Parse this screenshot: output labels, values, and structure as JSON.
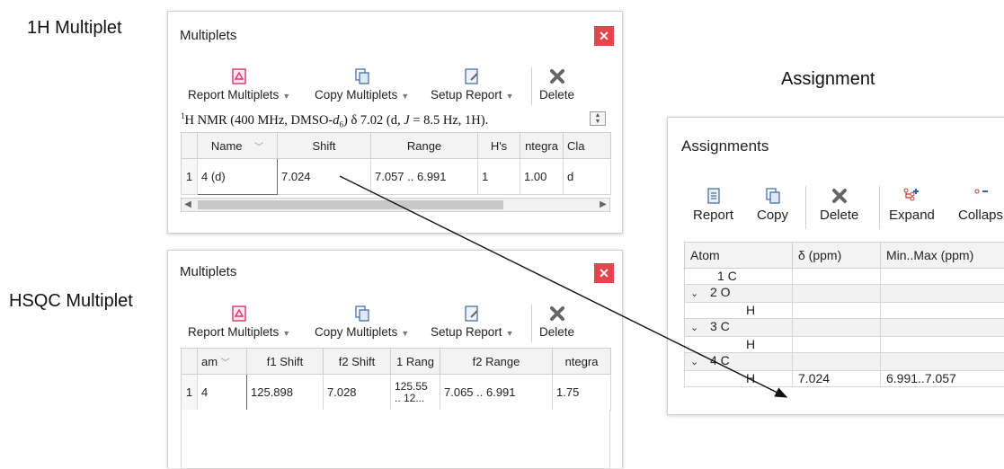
{
  "captions": {
    "h1": "1H Multiplet",
    "hsqc": "HSQC Multiplet",
    "assignment": "Assignment"
  },
  "mult1": {
    "title": "Multiplets",
    "close_icon": "close-icon",
    "toolbar": {
      "report": "Report Multiplets",
      "copy": "Copy Multiplets",
      "setup": "Setup Report",
      "delete": "Delete"
    },
    "report_text_prefix": "H NMR (400 MHz, DMSO-",
    "report_sup": "1",
    "report_sub": "6",
    "report_text_d": "d",
    "report_text_suffix": ") δ 7.02 (d, ",
    "report_J": "J",
    "report_text_tail": " = 8.5 Hz, 1H).",
    "headers": {
      "name": "Name",
      "shift": "Shift",
      "range": "Range",
      "hs": "H's",
      "integral": "ntegra",
      "class": "Cla"
    },
    "row": {
      "num": "1",
      "name": "4 (d)",
      "shift": "7.024",
      "range": "7.057 .. 6.991",
      "hs": "1",
      "integral": "1.00",
      "class": "d"
    }
  },
  "mult2": {
    "title": "Multiplets",
    "toolbar": {
      "report": "Report Multiplets",
      "copy": "Copy Multiplets",
      "setup": "Setup Report",
      "delete": "Delete"
    },
    "headers": {
      "name": "am",
      "f1shift": "f1 Shift",
      "f2shift": "f2 Shift",
      "f1range": "1 Rang",
      "f2range": "f2 Range",
      "integral": "ntegra"
    },
    "row": {
      "num": "1",
      "name": "4",
      "f1shift": "125.898",
      "f2shift": "7.028",
      "f1range_a": "125.55",
      "f1range_b": ".. 12...",
      "f2range": "7.065 .. 6.991",
      "integral": "1.75"
    }
  },
  "assign": {
    "title": "Assignments",
    "toolbar": {
      "report": "Report",
      "copy": "Copy",
      "delete": "Delete",
      "expand": "Expand",
      "collapse": "Collaps"
    },
    "headers": {
      "atom": "Atom",
      "delta": "δ (ppm)",
      "minmax": "Min..Max (ppm)"
    },
    "rows": [
      {
        "atom": "1 C",
        "chev": "",
        "indent": 1,
        "delta": "",
        "minmax": "",
        "grp": false
      },
      {
        "atom": "2 O",
        "chev": "⌄",
        "indent": 0,
        "delta": "",
        "minmax": "",
        "grp": true
      },
      {
        "atom": "H",
        "chev": "",
        "indent": 2,
        "delta": "",
        "minmax": "",
        "grp": false
      },
      {
        "atom": "3 C",
        "chev": "⌄",
        "indent": 0,
        "delta": "",
        "minmax": "",
        "grp": true
      },
      {
        "atom": "H",
        "chev": "",
        "indent": 2,
        "delta": "",
        "minmax": "",
        "grp": false
      },
      {
        "atom": "4 C",
        "chev": "⌄",
        "indent": 0,
        "delta": "",
        "minmax": "",
        "grp": true
      },
      {
        "atom": "H",
        "chev": "",
        "indent": 2,
        "delta": "7.024",
        "minmax": "6.991..7.057",
        "grp": false
      }
    ]
  },
  "colors": {
    "close": "#e2454d",
    "report_icon": "#d9336b",
    "copy_icon": "#4a6fa5",
    "delete_icon": "#666666",
    "expand_icon": "#c0392b"
  }
}
